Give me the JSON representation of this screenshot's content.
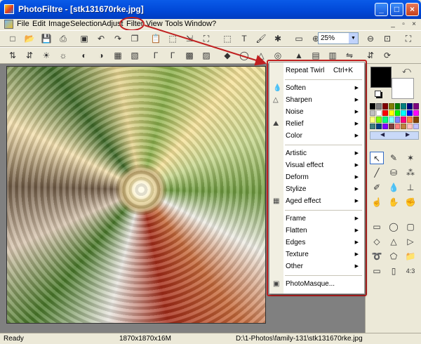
{
  "window": {
    "title": "PhotoFiltre - [stk131670rke.jpg]",
    "minimize_icon": "minimize-icon",
    "maximize_icon": "maximize-icon",
    "close_icon": "close-icon"
  },
  "menubar": [
    "File",
    "Edit",
    "Image",
    "Selection",
    "Adjust",
    "Filter",
    "View",
    "Tools",
    "Window",
    "?"
  ],
  "zoom": {
    "value": "25%"
  },
  "filter_menu": {
    "groups": [
      [
        {
          "label": "Repeat Twirl",
          "shortcut": "Ctrl+K",
          "icon": "",
          "sub": false
        }
      ],
      [
        {
          "label": "Soften",
          "icon": "droplet-icon",
          "sub": true
        },
        {
          "label": "Sharpen",
          "icon": "triangle-icon",
          "sub": true
        },
        {
          "label": "Noise",
          "icon": "",
          "sub": true
        },
        {
          "label": "Relief",
          "icon": "relief-icon",
          "sub": true
        },
        {
          "label": "Color",
          "icon": "",
          "sub": true
        }
      ],
      [
        {
          "label": "Artistic",
          "icon": "",
          "sub": true
        },
        {
          "label": "Visual effect",
          "icon": "",
          "sub": true
        },
        {
          "label": "Deform",
          "icon": "",
          "sub": true
        },
        {
          "label": "Stylize",
          "icon": "",
          "sub": true
        },
        {
          "label": "Aged effect",
          "icon": "aged-effect-icon",
          "sub": true
        }
      ],
      [
        {
          "label": "Frame",
          "icon": "",
          "sub": true
        },
        {
          "label": "Flatten",
          "icon": "",
          "sub": true
        },
        {
          "label": "Edges",
          "icon": "",
          "sub": true
        },
        {
          "label": "Texture",
          "icon": "",
          "sub": true
        },
        {
          "label": "Other",
          "icon": "",
          "sub": true
        }
      ],
      [
        {
          "label": "PhotoMasque...",
          "icon": "photomasque-icon",
          "sub": false
        }
      ]
    ]
  },
  "status": {
    "left": "Ready",
    "size": "1870x1870x16M",
    "path": "D:\\1-Photos\\family-131\\stk131670rke.jpg"
  },
  "colors": {
    "titlebar": "#0A5BE8",
    "highlight": "#C02020",
    "foreground": "#000000",
    "background": "#FFFFFF"
  },
  "palette": [
    "#000000",
    "#808080",
    "#800000",
    "#808000",
    "#008000",
    "#008080",
    "#000080",
    "#800080",
    "#C0C0C0",
    "#FFFFFF",
    "#FF0000",
    "#FFFF00",
    "#00FF00",
    "#00FFFF",
    "#0000FF",
    "#FF00FF",
    "#FFFF80",
    "#80FF00",
    "#00FF80",
    "#80FFFF",
    "#8080FF",
    "#FF0080",
    "#FF8040",
    "#804000",
    "#408080",
    "#004080",
    "#8000FF",
    "#804040",
    "#FF8080",
    "#C08040",
    "#FFC0C0",
    "#C0C0FF"
  ],
  "toolbar1_icons": [
    "new-icon",
    "open-icon",
    "save-icon",
    "print-icon",
    "scan-icon",
    "undo-icon",
    "redo-icon",
    "copy-icon",
    "paste-icon",
    "crop-icon",
    "image-size-icon",
    "canvas-size-icon",
    "select-all-icon",
    "text-icon",
    "paint-icon",
    "plugin-icon",
    "window-icon",
    "zoom-in-icon",
    "zoom-out-icon",
    "fit-icon",
    "fullscreen-icon"
  ],
  "toolbar2_icons": [
    "auto-level-icon",
    "auto-contrast-icon",
    "brightness-plus-icon",
    "brightness-minus-icon",
    "contrast-plus-icon",
    "contrast-minus-icon",
    "saturation-plus-icon",
    "saturation-minus-icon",
    "gamma-plus-icon",
    "gamma-minus-icon",
    "grayscale-icon",
    "sepia-icon",
    "color-icon",
    "blur-icon",
    "sharpen-icon",
    "more-blur-icon",
    "more-sharpen-icon",
    "color-balance-icon",
    "fade-icon",
    "flip-h-icon",
    "flip-v-icon",
    "rotate-icon"
  ],
  "tools": [
    "pointer-tool",
    "pipette-tool",
    "magic-wand-tool",
    "line-tool",
    "bucket-tool",
    "spray-tool",
    "brush-tool",
    "blur-tool",
    "stamp-tool",
    "finger-tool",
    "smudge-tool",
    "hand-tool"
  ],
  "shape_tools": [
    "rectangle-shape",
    "ellipse-shape",
    "rounded-rect-shape",
    "diamond-shape",
    "triangle-shape",
    "right-triangle-shape",
    "lasso-shape",
    "polygon-shape",
    "folder-shape",
    "stretch-shape",
    "fit-shape",
    "ratio-43-shape"
  ],
  "ratio_label": "4:3"
}
